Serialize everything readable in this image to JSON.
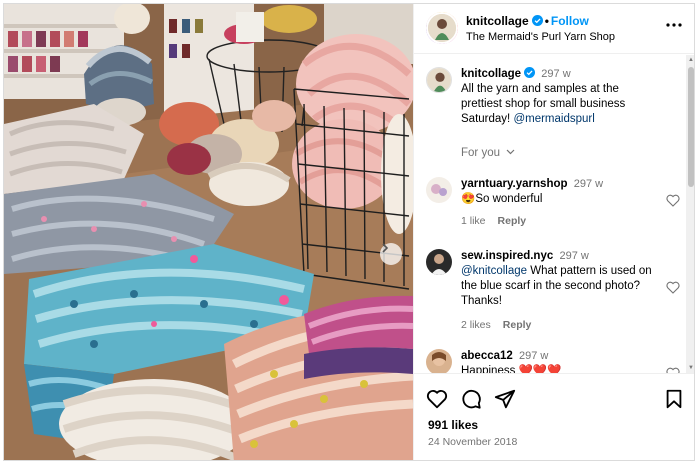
{
  "post": {
    "username": "knitcollage",
    "follow_label": "Follow",
    "location": "The Mermaid's Purl Yarn Shop",
    "more_icon": "more-horizontal-icon"
  },
  "caption": {
    "username": "knitcollage",
    "time": "297 w",
    "text": "All the yarn and samples at the prettiest shop for small business Saturday!",
    "mention": "@mermaidspurl",
    "for_you_label": "For you"
  },
  "comments": [
    {
      "username": "yarntuary.yarnshop",
      "time": "297 w",
      "emoji": "😍",
      "text": "So wonderful",
      "likes": "1 like",
      "reply": "Reply"
    },
    {
      "username": "sew.inspired.nyc",
      "time": "297 w",
      "mention": "@knitcollage",
      "text": "What pattern is used on the blue scarf in the second photo? Thanks!",
      "likes": "2 likes",
      "reply": "Reply"
    },
    {
      "username": "abecca12",
      "time": "297 w",
      "text": "Happiness",
      "emoji": "❤️❤️❤️"
    }
  ],
  "footer": {
    "likes": "991 likes",
    "date": "24 November 2018"
  },
  "colors": {
    "accent": "#0095f6",
    "muted": "#737373",
    "mention": "#00376b",
    "verified": "#0095f6"
  }
}
